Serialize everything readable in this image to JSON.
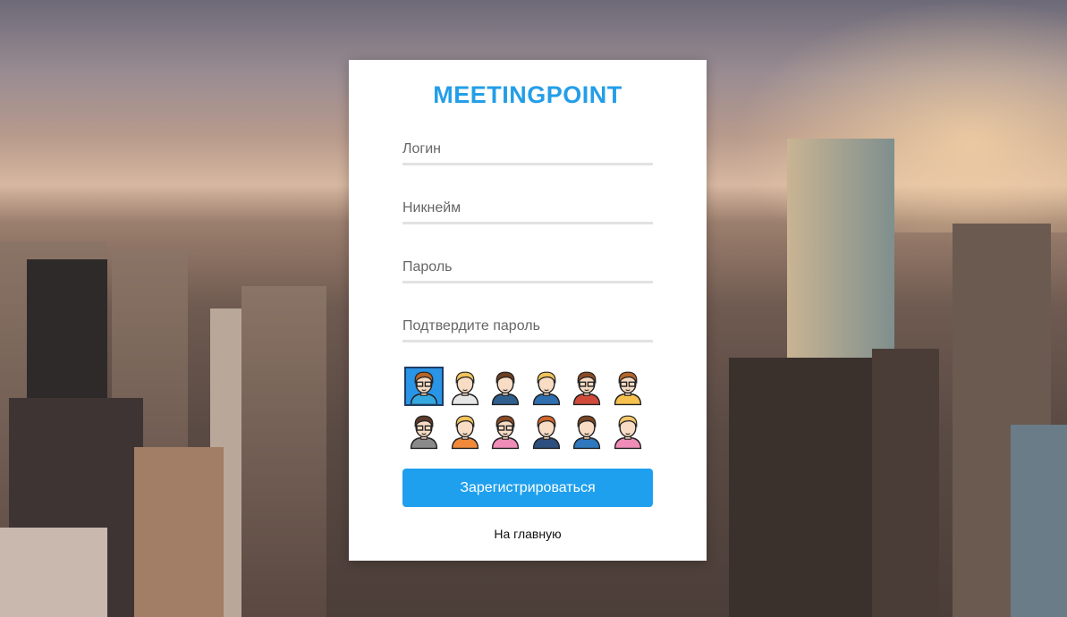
{
  "app": {
    "title": "MEETINGPOINT"
  },
  "form": {
    "login_placeholder": "Логин",
    "nickname_placeholder": "Никнейм",
    "password_placeholder": "Пароль",
    "confirm_placeholder": "Подтвердите пароль",
    "register_label": "Зарегистрироваться",
    "home_link": "На главную"
  },
  "colors": {
    "accent": "#1ea0ee",
    "title": "#239ee8",
    "selected_avatar": "#2a94e6"
  },
  "avatars": [
    {
      "hair": "#b5652b",
      "shirt": "#35a8e0",
      "selected": true,
      "glasses": true
    },
    {
      "hair": "#f0c35a",
      "shirt": "#e6e6e6",
      "selected": false,
      "glasses": false
    },
    {
      "hair": "#6b3e22",
      "shirt": "#2f5f8f",
      "selected": false,
      "glasses": false
    },
    {
      "hair": "#f0c35a",
      "shirt": "#2f6fb0",
      "selected": false,
      "glasses": false
    },
    {
      "hair": "#8a4a25",
      "shirt": "#d04a3a",
      "selected": false,
      "glasses": true
    },
    {
      "hair": "#b5652b",
      "shirt": "#f6c14e",
      "selected": false,
      "glasses": true
    },
    {
      "hair": "#5a3a2a",
      "shirt": "#8a8a8a",
      "selected": false,
      "glasses": true
    },
    {
      "hair": "#f0c35a",
      "shirt": "#f08a3a",
      "selected": false,
      "glasses": false
    },
    {
      "hair": "#8a4a25",
      "shirt": "#ef8cb8",
      "selected": false,
      "glasses": true
    },
    {
      "hair": "#d0652b",
      "shirt": "#2d4f80",
      "selected": false,
      "glasses": false
    },
    {
      "hair": "#7a4525",
      "shirt": "#2f78c0",
      "selected": false,
      "glasses": false
    },
    {
      "hair": "#f2c66a",
      "shirt": "#ef8cb8",
      "selected": false,
      "glasses": false
    }
  ]
}
